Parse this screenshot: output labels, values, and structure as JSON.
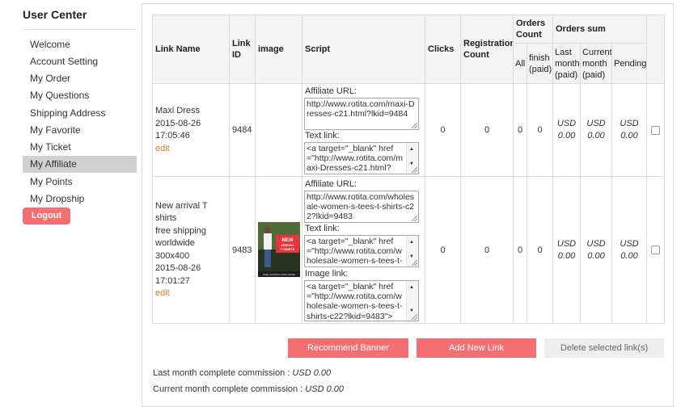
{
  "sidebar": {
    "title": "User Center",
    "items": [
      {
        "label": "Welcome"
      },
      {
        "label": "Account Setting"
      },
      {
        "label": "My Order"
      },
      {
        "label": "My Questions"
      },
      {
        "label": "Shipping Address"
      },
      {
        "label": "My Favorite"
      },
      {
        "label": "My Ticket"
      },
      {
        "label": "My Affiliate",
        "active": true
      },
      {
        "label": "My Points"
      },
      {
        "label": "My Dropship"
      }
    ],
    "logout_label": "Logout"
  },
  "table": {
    "headers": {
      "link_name": "Link Name",
      "link_id": "Link ID",
      "image": "image",
      "script": "Script",
      "clicks": "Clicks",
      "registration_count": "Registration Count",
      "orders_count": "Orders Count",
      "orders_sum": "Orders sum",
      "all": "All",
      "finish_paid": "finish (paid)",
      "last_month_paid": "Last month (paid)",
      "current_month_paid": "Current month (paid)",
      "pending": "Pending"
    },
    "rows": [
      {
        "name": "Maxi Dress",
        "date": "2015-08-26",
        "time": "17:05:46",
        "edit": "edit",
        "link_id": "9484",
        "affiliate_url_label": "Affiliate URL:",
        "affiliate_url": "http://www.rotita.com/maxi-Dresses-c21.html?lkid=9484",
        "text_link_label": "Text link:",
        "text_link": "<a target=\"_blank\" href=\"http://www.rotita.com/maxi-Dresses-c21.html?",
        "clicks": "0",
        "registration": "0",
        "orders_all": "0",
        "orders_finish": "0",
        "last_month": "USD 0.00",
        "current_month": "USD 0.00",
        "pending": "USD 0.00"
      },
      {
        "name_lines": [
          "New arrival T shirts",
          "free shipping",
          "worldwide",
          "300x400",
          "2015-08-26",
          "17:01:27"
        ],
        "edit": "edit",
        "link_id": "9483",
        "image_alt": "NEW ARRIVAL T SHIRTS",
        "image_footer": "FREE SHIPPING WORLDWIDE",
        "affiliate_url_label": "Affiliate URL:",
        "affiliate_url": "http://www.rotita.com/wholesale-women-s-tees-t-shirts-c22?lkid=9483",
        "text_link_label": "Text link:",
        "text_link": "<a target=\"_blank\" href=\"http://www.rotita.com/wholesale-women-s-tees-t-",
        "image_link_label": "Image link:",
        "image_link": "<a target=\"_blank\" href=\"http://www.rotita.com/wholesale-women-s-tees-t-shirts-c22?lkid=9483\">",
        "clicks": "0",
        "registration": "0",
        "orders_all": "0",
        "orders_finish": "0",
        "last_month": "USD 0.00",
        "current_month": "USD 0.00",
        "pending": "USD 0.00"
      }
    ]
  },
  "actions": {
    "recommend_banner": "Recommend Banner",
    "add_new_link": "Add New Link",
    "delete_selected": "Delete selected link(s)"
  },
  "commission": {
    "last_month_label": "Last month complete commission :",
    "last_month_value": "USD 0.00",
    "current_month_label": "Current month complete commission :",
    "current_month_value": "USD 0.00"
  },
  "colors": {
    "accent_red": "#f36f71",
    "edit_orange": "#e07a2c",
    "active_bg": "#d0d0d0"
  }
}
